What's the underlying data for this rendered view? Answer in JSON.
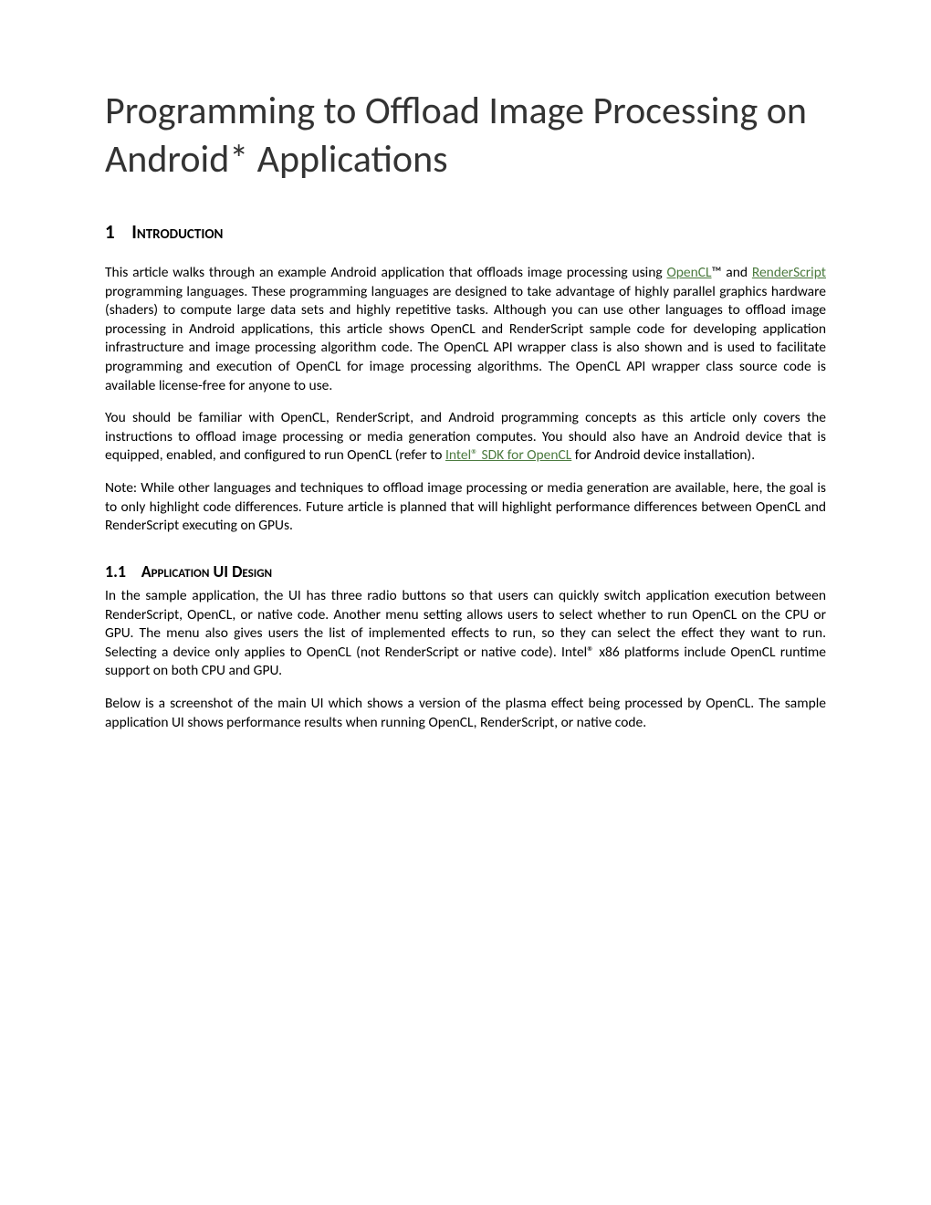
{
  "title": "Programming to Offload Image Processing on Android* Applications",
  "section1": {
    "number": "1",
    "heading": "Introduction"
  },
  "para1_a": "This article walks through an example Android application that offloads image processing using ",
  "link_opencl": "OpenCL",
  "para1_b": "™ and ",
  "link_renderscript": "RenderScript",
  "para1_c": " programming languages. These programming languages are designed to take advantage of highly parallel graphics hardware (shaders) to compute large data sets and highly repetitive tasks. Although you can use other languages to offload image processing in Android applications, this article shows OpenCL and RenderScript sample code for developing application infrastructure and image processing algorithm code. The OpenCL API wrapper class is also shown and is used to facilitate programming and execution of OpenCL for image processing algorithms. The OpenCL API wrapper class source code is available license-free for anyone to use.",
  "para2_a": "You should be familiar with OpenCL, RenderScript, and Android programming concepts as this article only covers the instructions to offload image processing or media generation computes. You should also have an Android device that is equipped, enabled, and configured to run OpenCL (refer to ",
  "link_intel": "Intel® SDK for OpenCL",
  "para2_b": " for Android device installation).",
  "para3": "Note: While other languages and techniques to offload image processing or media generation are available, here, the goal is to only highlight code differences. Future article is planned that will highlight performance differences between OpenCL and RenderScript executing on GPUs.",
  "section11": {
    "number": "1.1",
    "heading": "Application UI Design"
  },
  "para4": "In the sample application, the UI has three radio buttons so that users can quickly switch application execution between RenderScript, OpenCL, or native code. Another menu setting allows users to select whether to run OpenCL on the CPU or GPU. The menu also gives users the list of implemented effects to run, so they can select the effect they want to run. Selecting a device only applies to OpenCL (not RenderScript or native code). Intel® x86 platforms include OpenCL runtime support on both CPU and GPU.",
  "para5": "Below is a screenshot of the main UI which shows a version of the plasma effect being processed by OpenCL. The sample application UI shows performance results when running OpenCL, RenderScript, or native code."
}
